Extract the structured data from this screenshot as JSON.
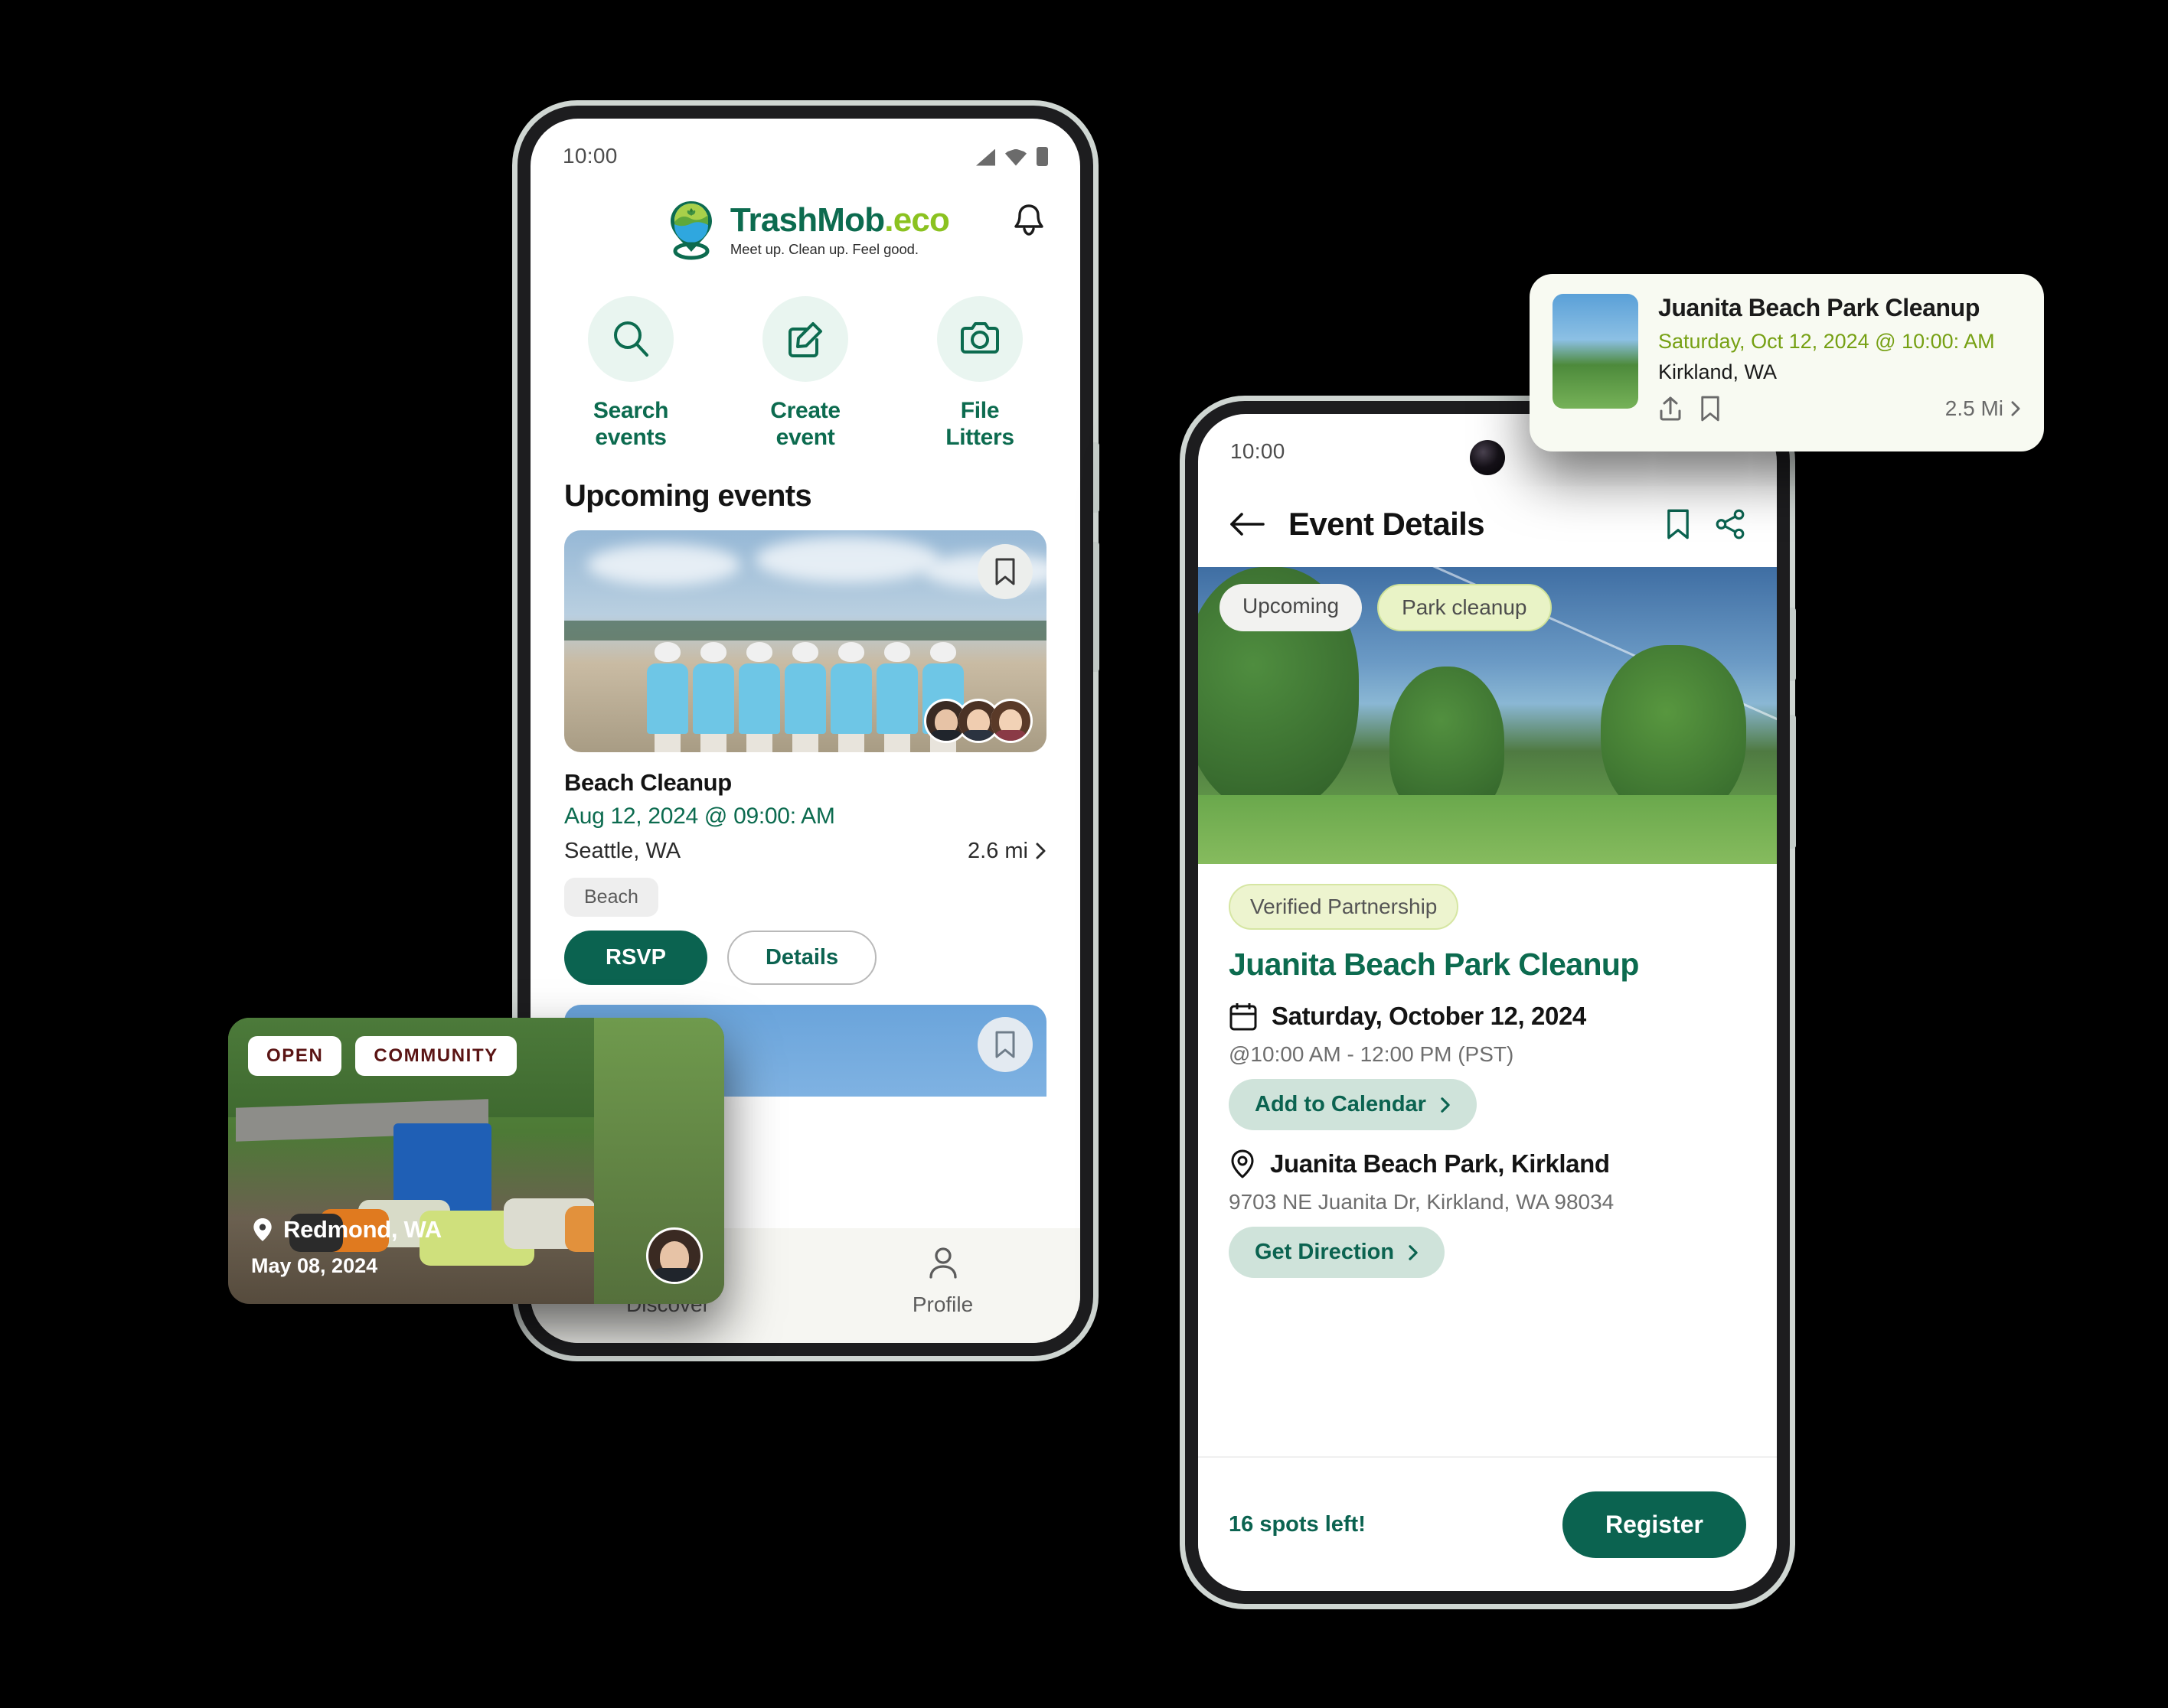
{
  "phone_home": {
    "status": {
      "time": "10:00",
      "icons": [
        "signal-icon",
        "wifi-icon",
        "battery-icon"
      ]
    },
    "brand": {
      "name_part1": "TrashMob",
      "name_part2": ".eco",
      "tagline": "Meet up. Clean up. Feel good."
    },
    "notification_icon": "bell-icon",
    "quick_actions": [
      {
        "icon": "search-icon",
        "label": "Search\nevents",
        "line1": "Search",
        "line2": "events"
      },
      {
        "icon": "edit-icon",
        "label": "Create event",
        "line1": "Create",
        "line2": "event"
      },
      {
        "icon": "camera-icon",
        "label": "File Litters",
        "line1": "File",
        "line2": "Litters"
      }
    ],
    "section_title": "Upcoming events",
    "event": {
      "title": "Beach Cleanup",
      "date": "Aug 12, 2024 @ 09:00: AM",
      "location": "Seattle, WA",
      "distance": "2.6 mi",
      "tag": "Beach",
      "rsvp_label": "RSVP",
      "details_label": "Details",
      "bookmark_icon": "bookmark-icon",
      "attendee_count": 3
    },
    "bottom_nav": [
      {
        "icon": "map-icon",
        "label": "Discover"
      },
      {
        "icon": "person-icon",
        "label": "Profile"
      }
    ]
  },
  "phone_details": {
    "status": {
      "time": "10:00"
    },
    "appbar": {
      "back_icon": "arrow-left-icon",
      "title": "Event Details",
      "bookmark_icon": "bookmark-icon",
      "share_icon": "share-icon"
    },
    "hero_chips": [
      {
        "label": "Upcoming",
        "style": "grey"
      },
      {
        "label": "Park cleanup",
        "style": "lime"
      }
    ],
    "badge": "Verified Partnership",
    "title": "Juanita Beach Park Cleanup",
    "date": "Saturday, October 12, 2024",
    "time_range": "@10:00 AM - 12:00 PM (PST)",
    "calendar_button": "Add to Calendar",
    "venue": "Juanita Beach Park, Kirkland",
    "address": "9703 NE Juanita Dr, Kirkland, WA 98034",
    "direction_button": "Get Direction",
    "spots_left": "16 spots left!",
    "register_button": "Register",
    "calendar_icon": "calendar-icon",
    "pin_icon": "map-pin-icon"
  },
  "float_card": {
    "title": "Juanita Beach Park Cleanup",
    "date": "Saturday, Oct 12, 2024 @ 10:00: AM",
    "location": "Kirkland, WA",
    "distance": "2.5 Mi",
    "share_icon": "share-upload-icon",
    "bookmark_icon": "bookmark-icon",
    "chevron_icon": "chevron-right-icon"
  },
  "litter_card": {
    "badges": [
      "OPEN",
      "COMMUNITY"
    ],
    "location": "Redmond, WA",
    "date": "May 08, 2024",
    "pin_icon": "map-pin-icon",
    "avatar": "reporter-avatar"
  },
  "colors": {
    "brand_green": "#0c6b4f",
    "button_green": "#0b6350",
    "lime": "#8bc220",
    "mint": "#e9f5f0",
    "chip_lime": "#e9f3c6",
    "pill_mint": "#cfe3da"
  }
}
